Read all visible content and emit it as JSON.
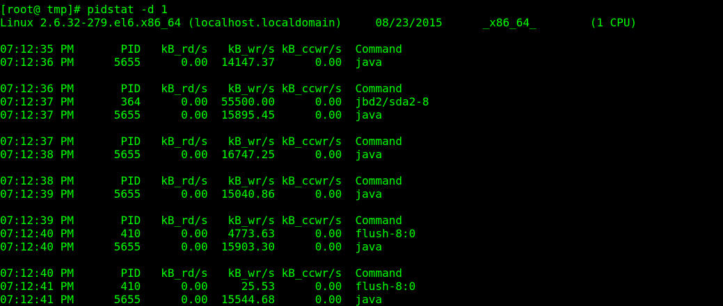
{
  "terminal": {
    "text_color": "#00ff00",
    "background_color": "#000000",
    "prompt_line": "[root@ tmp]# pidstat -d 1",
    "system_line": "Linux 2.6.32-279.el6.x86_64 (localhost.localdomain)     08/23/2015      _x86_64_        (1 CPU)",
    "blocks": [
      {
        "header": "07:12:35 PM       PID   kB_rd/s   kB_wr/s kB_ccwr/s  Command",
        "rows": [
          "07:12:36 PM      5655      0.00  14147.37      0.00  java"
        ]
      },
      {
        "header": "07:12:36 PM       PID   kB_rd/s   kB_wr/s kB_ccwr/s  Command",
        "rows": [
          "07:12:37 PM       364      0.00  55500.00      0.00  jbd2/sda2-8",
          "07:12:37 PM      5655      0.00  15895.45      0.00  java"
        ]
      },
      {
        "header": "07:12:37 PM       PID   kB_rd/s   kB_wr/s kB_ccwr/s  Command",
        "rows": [
          "07:12:38 PM      5655      0.00  16747.25      0.00  java"
        ]
      },
      {
        "header": "07:12:38 PM       PID   kB_rd/s   kB_wr/s kB_ccwr/s  Command",
        "rows": [
          "07:12:39 PM      5655      0.00  15040.86      0.00  java"
        ]
      },
      {
        "header": "07:12:39 PM       PID   kB_rd/s   kB_wr/s kB_ccwr/s  Command",
        "rows": [
          "07:12:40 PM       410      0.00   4773.63      0.00  flush-8:0",
          "07:12:40 PM      5655      0.00  15903.30      0.00  java"
        ]
      },
      {
        "header": "07:12:40 PM       PID   kB_rd/s   kB_wr/s kB_ccwr/s  Command",
        "rows": [
          "07:12:41 PM       410      0.00     25.53      0.00  flush-8:0",
          "07:12:41 PM      5655      0.00  15544.68      0.00  java"
        ]
      }
    ]
  }
}
